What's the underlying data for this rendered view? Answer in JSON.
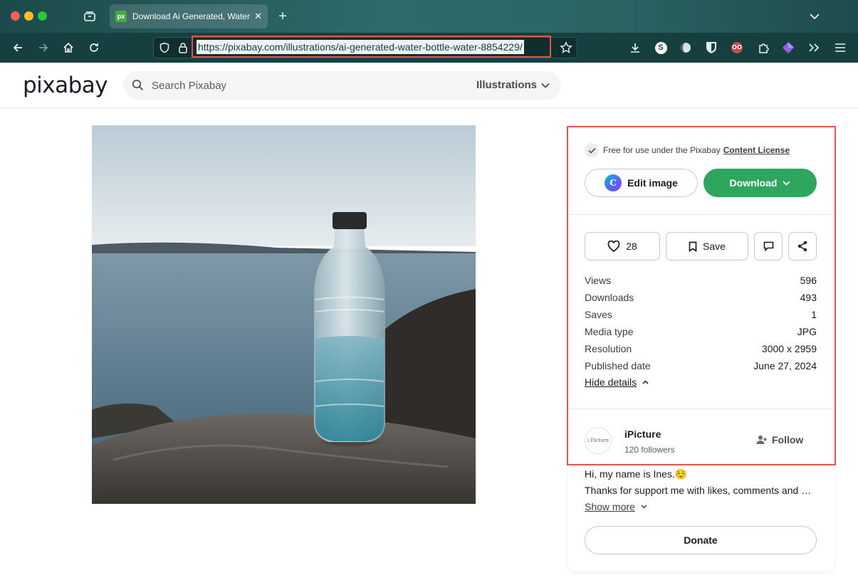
{
  "browser": {
    "tab_title": "Download Ai Generated, Water Bottle",
    "tab_favicon": "px",
    "url": "https://pixabay.com/illustrations/ai-generated-water-bottle-water-8854229/"
  },
  "header": {
    "logo": "pixabay",
    "search_placeholder": "Search Pixabay",
    "media_type": "Illustrations"
  },
  "license": {
    "prefix": "Free for use under the Pixabay",
    "link": "Content License"
  },
  "buttons": {
    "edit_image": "Edit image",
    "download": "Download",
    "save": "Save",
    "donate": "Donate"
  },
  "likes": "28",
  "stats": [
    {
      "label": "Views",
      "value": "596"
    },
    {
      "label": "Downloads",
      "value": "493"
    },
    {
      "label": "Saves",
      "value": "1"
    },
    {
      "label": "Media type",
      "value": "JPG"
    },
    {
      "label": "Resolution",
      "value": "3000 x 2959"
    },
    {
      "label": "Published date",
      "value": "June 27, 2024"
    }
  ],
  "hide_details": "Hide details",
  "author": {
    "name": "iPicture",
    "followers": "120 followers",
    "follow_label": "Follow",
    "avatar_text": "i Picture"
  },
  "bio": {
    "line1": "Hi, my name is Ines.☺️",
    "line2": "Thanks for support me with likes, comments and downloads",
    "show_more": "Show more"
  },
  "colors": {
    "download_green": "#2ea65e",
    "highlight_red": "#e8544b",
    "chrome_teal": "#15403f"
  }
}
